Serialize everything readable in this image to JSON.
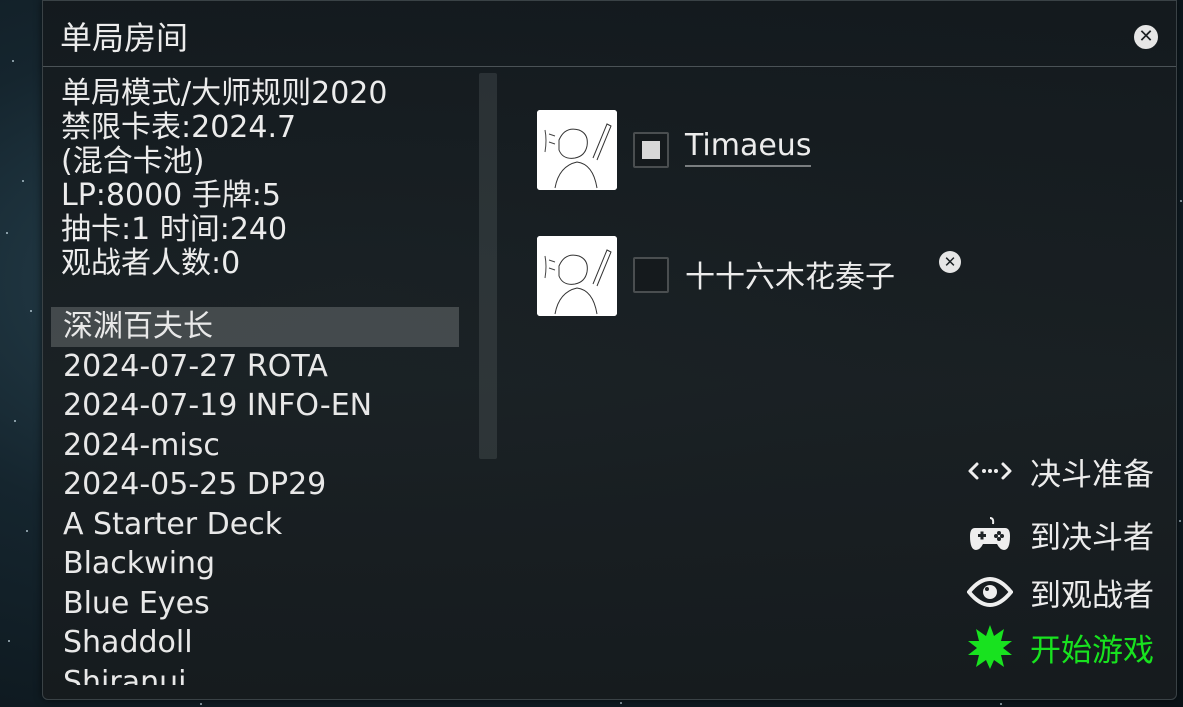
{
  "window": {
    "title": "单局房间",
    "close_icon": "close-icon"
  },
  "room_info": {
    "mode": "单局模式/大师规则2020",
    "banlist": "禁限卡表:2024.7",
    "pool": "(混合卡池)",
    "lp_hand": "LP:8000 手牌:5",
    "draw_time": "抽卡:1 时间:240",
    "spectators": "观战者人数:0"
  },
  "deck_list": {
    "selected_index": 0,
    "items": [
      "深渊百夫长",
      "2024-07-27 ROTA",
      "2024-07-19 INFO-EN",
      "2024-misc",
      "2024-05-25 DP29",
      "A Starter Deck",
      "Blackwing",
      "Blue Eyes",
      "Shaddoll",
      "Shiranui"
    ]
  },
  "players": [
    {
      "name": "Timaeus",
      "ready": true,
      "kick": false
    },
    {
      "name": "十十六木花奏子",
      "ready": false,
      "kick": true
    }
  ],
  "actions": {
    "ready": {
      "label": "决斗准备",
      "icon": "arrows-exchange-icon"
    },
    "to_duelist": {
      "label": "到决斗者",
      "icon": "gamepad-icon"
    },
    "to_spectator": {
      "label": "到观战者",
      "icon": "eye-icon"
    },
    "start": {
      "label": "开始游戏",
      "icon": "starburst-icon",
      "color": "#18e21f"
    }
  }
}
